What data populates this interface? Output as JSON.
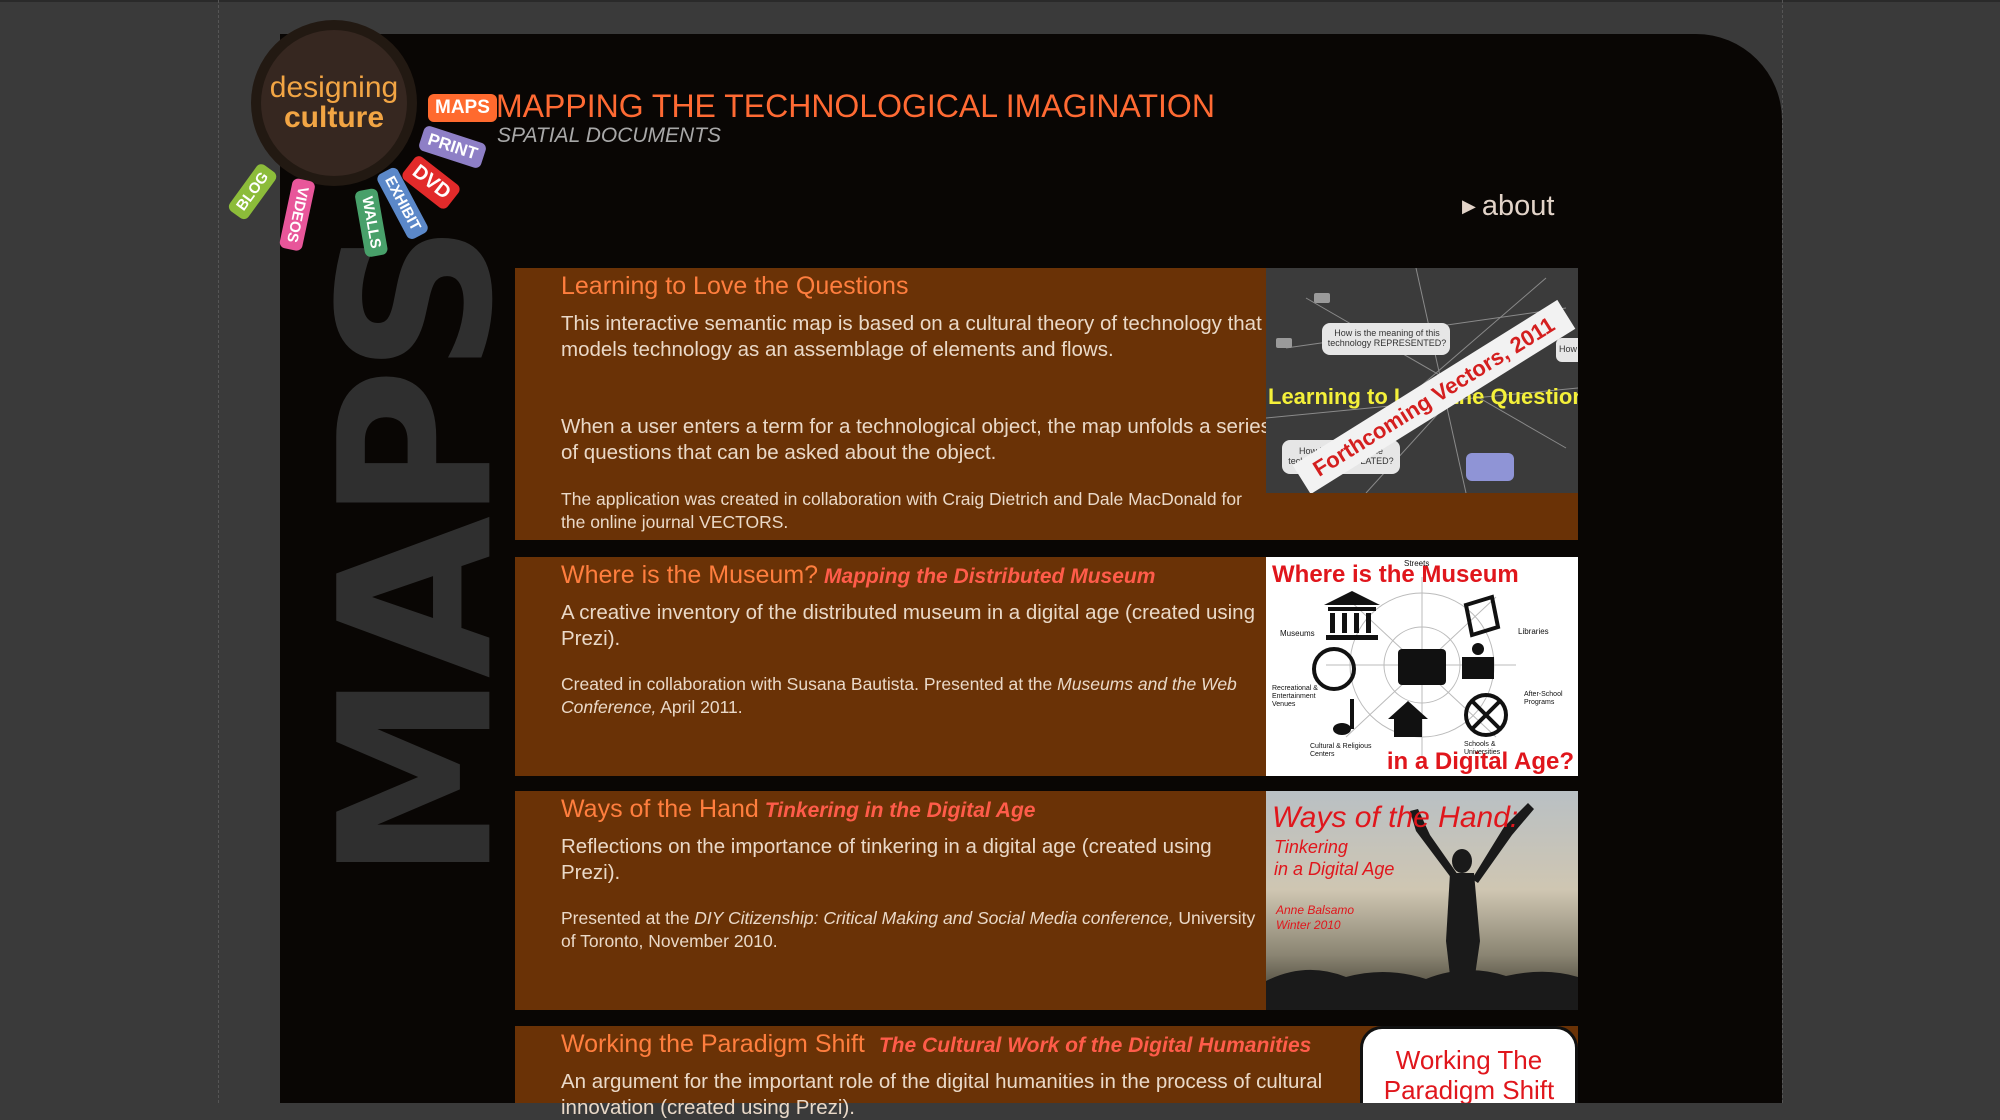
{
  "logo": {
    "line1": "designing",
    "line2": "culture"
  },
  "nav_tags": {
    "maps": "MAPS",
    "print": "PRINT",
    "dvd": "DVD",
    "exhibit": "EXHIBIT",
    "walls": "WALLS",
    "videos": "VIDEOS",
    "blog": "BLOG"
  },
  "header": {
    "title": "MAPPING THE TECHNOLOGICAL IMAGINATION",
    "subtitle": "SPATIAL DOCUMENTS"
  },
  "side_label": "MAPS",
  "about": {
    "label": "about"
  },
  "colors": {
    "accent": "#ff6a33",
    "card_bg": "#6a3206",
    "panel_bg": "#090604",
    "page_bg": "#3a3a3a"
  },
  "cards": [
    {
      "title": "Learning to Love the Questions",
      "paragraphs": [
        "This interactive semantic map is based on a cultural theory of technology that models technology as an assemblage of elements and flows.",
        "When a user enters a term for a technological object, the map unfolds a series of questions that can be asked about the object.",
        "The application was created in collaboration with Craig Dietrich and Dale MacDonald for the online journal VECTORS."
      ],
      "thumb": {
        "bubble1": "How is the meaning of this technology REPRESENTED?",
        "bubble2": "How is the use of the technology REGULATED?",
        "bubble3": "How",
        "headline": "Learning to Love the Questions",
        "banner": "Forthcoming Vectors, 2011"
      }
    },
    {
      "title": "Where is the Museum?",
      "subtitle": "Mapping the Distributed Museum",
      "paragraphs": [
        "A creative inventory of the distributed museum in a digital age (created using Prezi).",
        "Created in collaboration with Susana Bautista. Presented at the",
        "Museums and the Web Conference,",
        "April 2011."
      ],
      "thumb": {
        "title_top": "Where is the Museum",
        "title_bottom": "in a Digital Age?",
        "labels": [
          "Streets",
          "Museums",
          "Libraries",
          "Recreational & Entertainment Venues",
          "After-School Programs",
          "Cultural & Religious Centers",
          "Schools & Universities"
        ]
      }
    },
    {
      "title": "Ways of the Hand",
      "subtitle": "Tinkering in the Digital Age",
      "paragraphs": [
        "Reflections on the importance of tinkering in a digital age (created using Prezi).",
        "Presented at the",
        "DIY Citizenship: Critical Making and Social Media conference,",
        "University of Toronto, November 2010."
      ],
      "thumb": {
        "title": "Ways of the Hand:",
        "sub1": "Tinkering",
        "sub2": "in a Digital Age",
        "author": "Anne Balsamo",
        "date": "Winter 2010"
      }
    },
    {
      "title": "Working the Paradigm Shift",
      "subtitle": "The Cultural Work of the Digital Humanities",
      "paragraphs": [
        "An argument for the important role of the digital humanities in the process of cultural innovation (created using Prezi)."
      ],
      "thumb": {
        "line1": "Working The",
        "line2": "Paradigm Shift"
      }
    }
  ]
}
